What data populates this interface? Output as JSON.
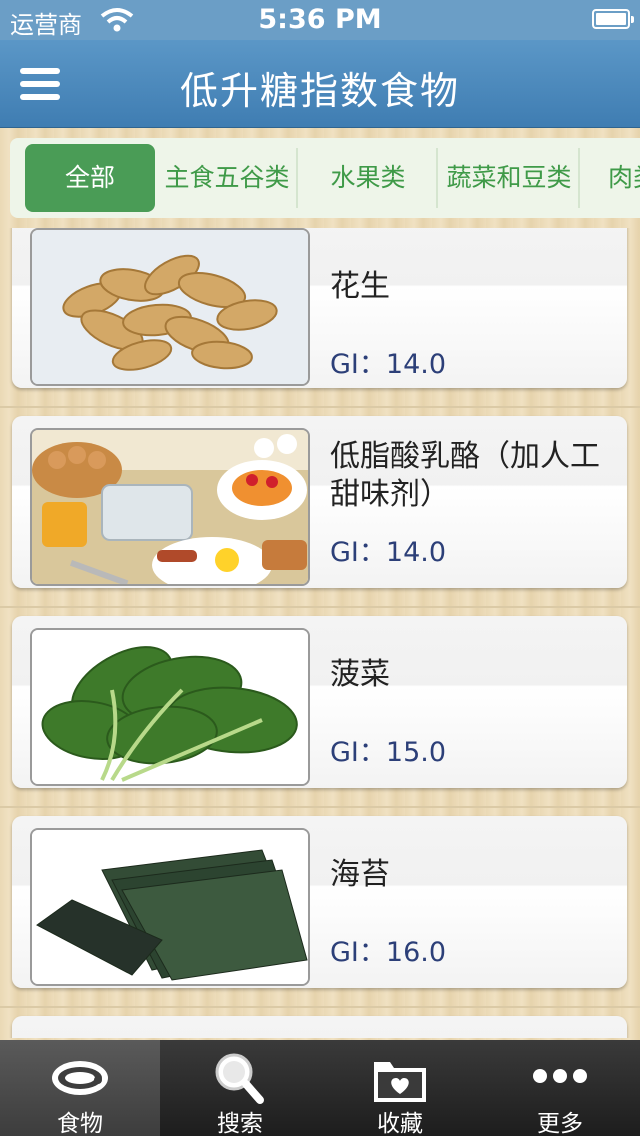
{
  "status_bar": {
    "carrier": "运营商",
    "time": "5:36 PM"
  },
  "navbar": {
    "title": "低升糖指数食物"
  },
  "categories": [
    {
      "label": "全部",
      "active": true
    },
    {
      "label": "主食五谷类",
      "active": false
    },
    {
      "label": "水果类",
      "active": false
    },
    {
      "label": "蔬菜和豆类",
      "active": false
    },
    {
      "label": "肉类",
      "active": false
    }
  ],
  "foods": [
    {
      "name": "花生",
      "gi": "GI：14.0",
      "image": "peanuts"
    },
    {
      "name": "低脂酸乳酪（加人工甜味剂）",
      "gi": "GI：14.0",
      "image": "breakfast"
    },
    {
      "name": "菠菜",
      "gi": "GI：15.0",
      "image": "spinach"
    },
    {
      "name": "海苔",
      "gi": "GI：16.0",
      "image": "seaweed"
    }
  ],
  "tabbar": [
    {
      "label": "食物",
      "icon": "meat-icon",
      "active": true
    },
    {
      "label": "搜索",
      "icon": "search-icon",
      "active": false
    },
    {
      "label": "收藏",
      "icon": "favorites-folder-icon",
      "active": false
    },
    {
      "label": "更多",
      "icon": "more-dots-icon",
      "active": false
    }
  ],
  "colors": {
    "navbar": "#4a89bd",
    "active_category": "#4a9c56",
    "category_text": "#3f9a48",
    "gi_text": "#2c3f78"
  }
}
